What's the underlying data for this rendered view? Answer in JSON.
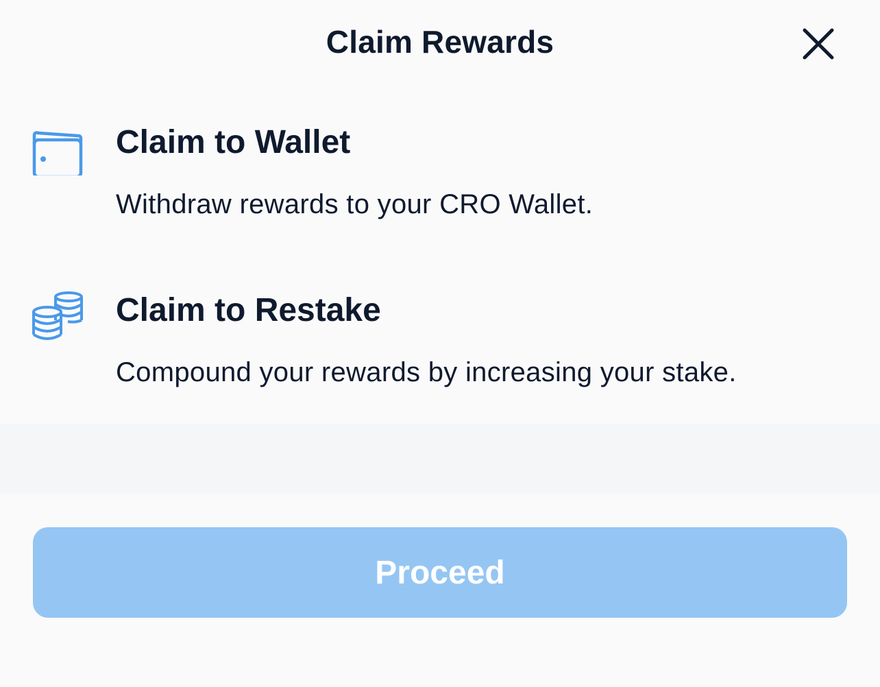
{
  "header": {
    "title": "Claim Rewards",
    "close_icon": "close-icon"
  },
  "options": [
    {
      "id": "wallet",
      "icon": "wallet-icon",
      "title": "Claim to Wallet",
      "description": "Withdraw rewards to your CRO Wallet."
    },
    {
      "id": "restake",
      "icon": "coins-stack-icon",
      "title": "Claim to Restake",
      "description": "Compound your rewards by increasing your stake."
    }
  ],
  "footer": {
    "proceed_label": "Proceed",
    "proceed_state": "disabled"
  },
  "colors": {
    "background": "#fafafb",
    "text": "#0f1a2e",
    "icon_accent": "#4a99e9",
    "button_disabled": "#95c6f3",
    "button_text": "#ffffff"
  }
}
